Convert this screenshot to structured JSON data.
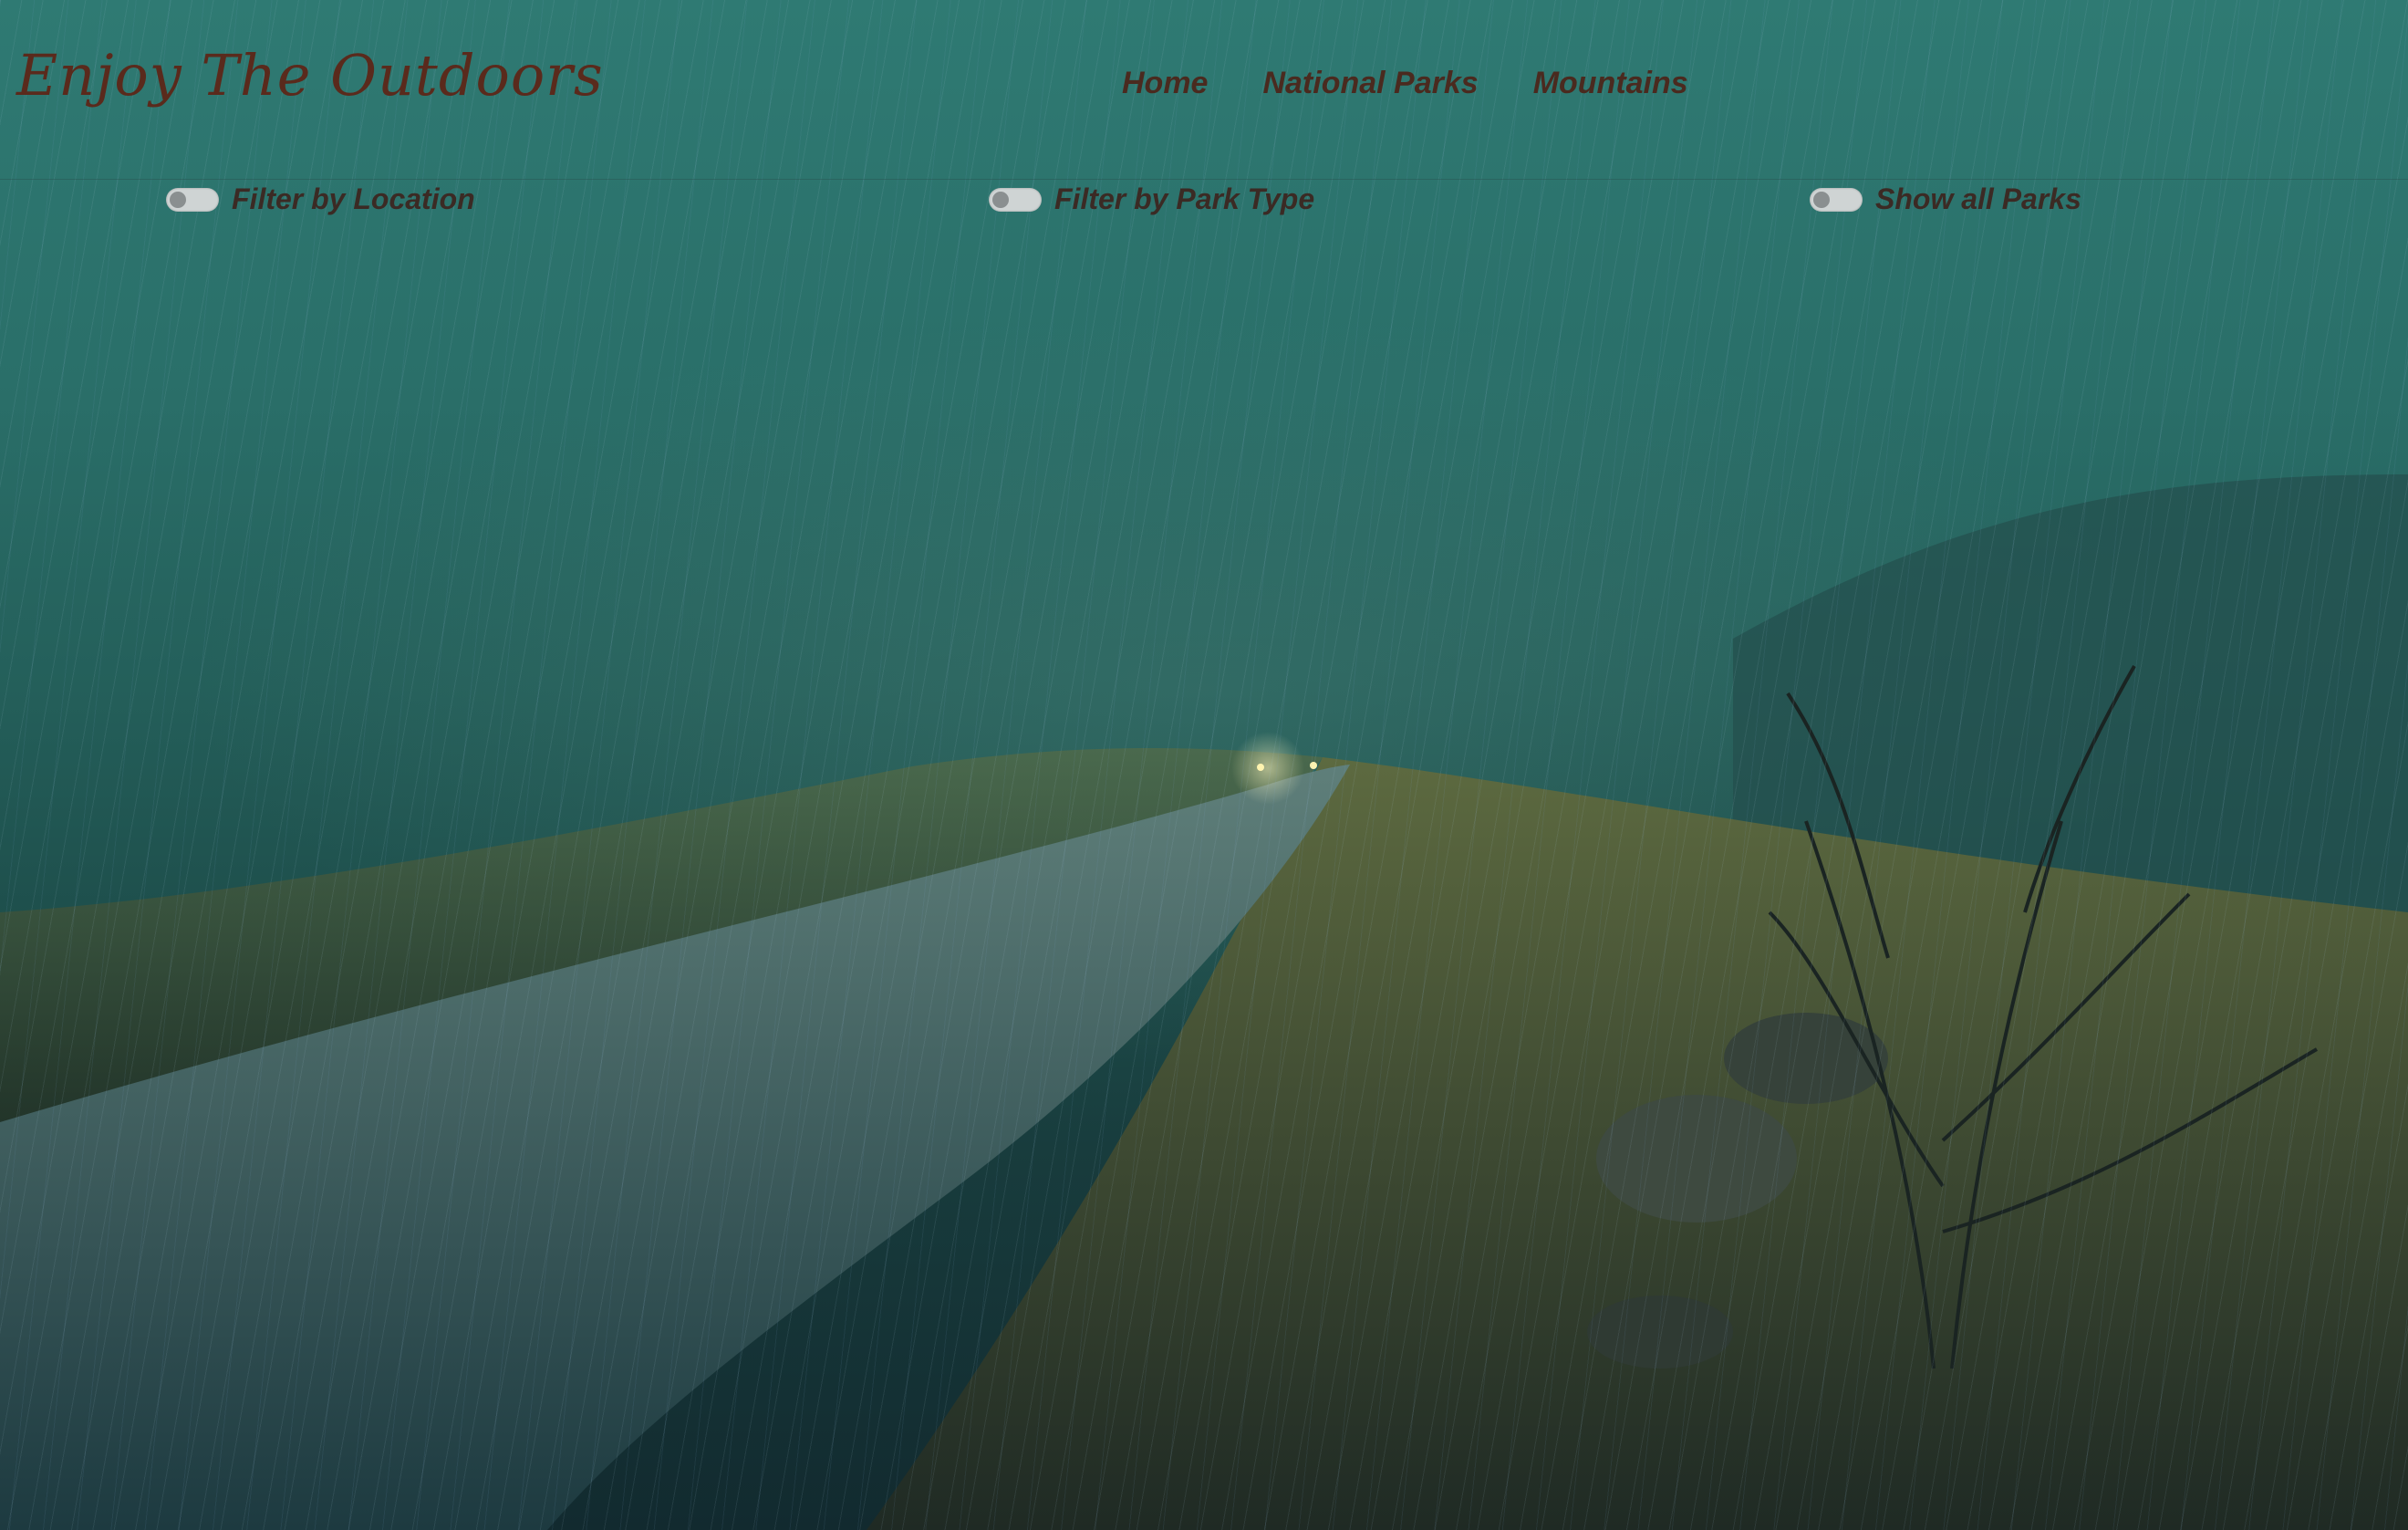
{
  "header": {
    "logo_text": "Enjoy The Outdoors",
    "nav": [
      {
        "label": "Home"
      },
      {
        "label": "National Parks"
      },
      {
        "label": "Mountains"
      }
    ]
  },
  "filters": [
    {
      "label": "Filter by Location",
      "checked": false
    },
    {
      "label": "Filter by Park Type",
      "checked": false
    },
    {
      "label": "Show all Parks",
      "checked": false
    }
  ],
  "colors": {
    "logo": "#5a2a1c",
    "nav_text": "#4a2a1f",
    "background_teal": "#2a6f69",
    "toggle_track": "#cfd4d4",
    "toggle_knob": "#8a8f90"
  }
}
